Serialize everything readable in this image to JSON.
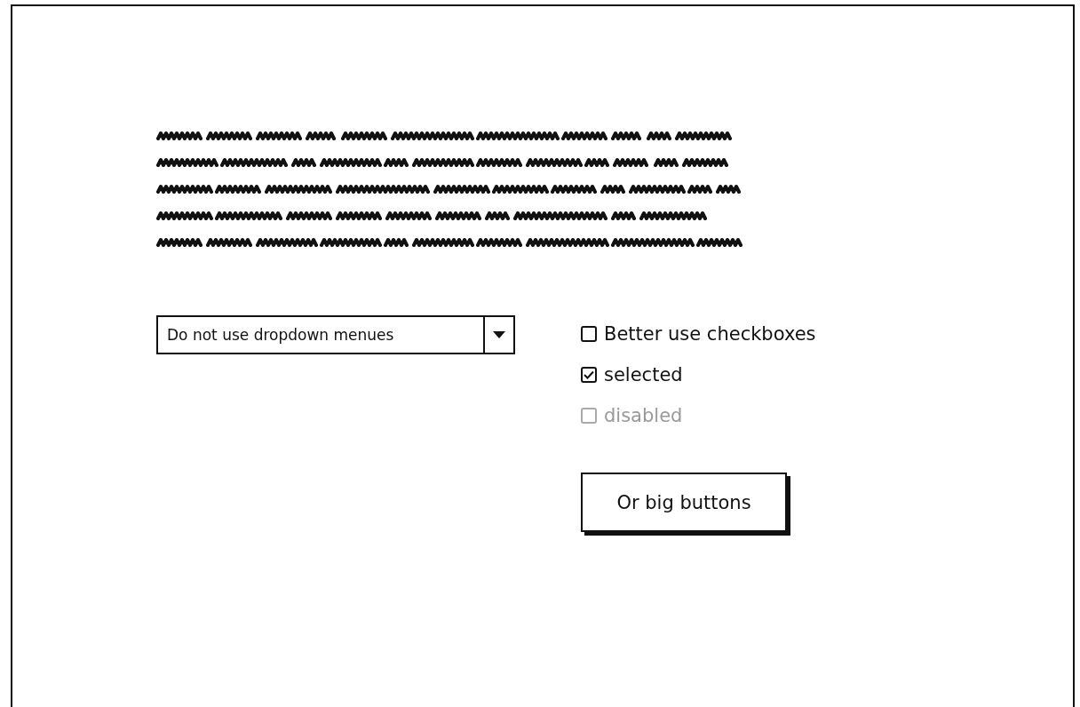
{
  "dropdown": {
    "value": "Do not use dropdown menues",
    "expanded": false
  },
  "checkboxes": [
    {
      "label": "Better use checkboxes",
      "checked": false,
      "disabled": false
    },
    {
      "label": "selected",
      "checked": true,
      "disabled": false
    },
    {
      "label": "disabled",
      "checked": false,
      "disabled": true
    }
  ],
  "button": {
    "label": "Or big buttons"
  }
}
